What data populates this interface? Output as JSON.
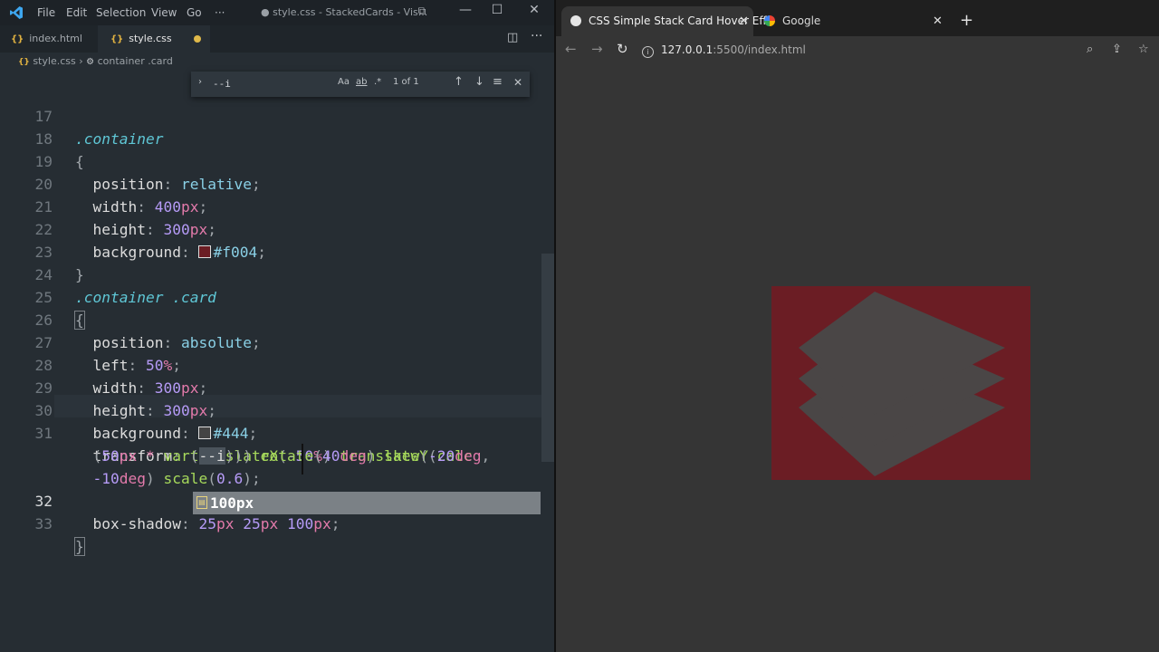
{
  "vscode": {
    "menu": [
      "File",
      "Edit",
      "Selection",
      "View",
      "Go",
      "···"
    ],
    "window_title": "● style.css - StackedCards - Vis...",
    "tabs": [
      {
        "icon": "{}",
        "label": "index.html"
      },
      {
        "icon": "{}",
        "label": "style.css",
        "unsaved": true
      }
    ],
    "breadcrumb": {
      "file": "style.css",
      "separator": "›",
      "symbol": "container .card"
    },
    "find_widget": {
      "value": "--i",
      "match_case": "Aa",
      "whole_word": "ab",
      "regex": ".*",
      "result": "1 of 1"
    },
    "lines": [
      {
        "n": "17",
        "text": ".container"
      },
      {
        "n": "18",
        "text": "{"
      },
      {
        "n": "19",
        "text": "  position: relative;"
      },
      {
        "n": "20",
        "text": "  width: 400px;"
      },
      {
        "n": "21",
        "text": "  height: 300px;"
      },
      {
        "n": "22",
        "text": "  background: ■#f004;"
      },
      {
        "n": "23",
        "text": "}"
      },
      {
        "n": "24",
        "text": ".container .card"
      },
      {
        "n": "25",
        "text": "{"
      },
      {
        "n": "26",
        "text": "  position: absolute;"
      },
      {
        "n": "27",
        "text": "  left: 50%;"
      },
      {
        "n": "28",
        "text": "  width: 300px;"
      },
      {
        "n": "29",
        "text": "  height: 300px;"
      },
      {
        "n": "30",
        "text": "  background: □#444;"
      },
      {
        "n": "31",
        "text": "  transform: translateX(-50%) translateY(calc"
      },
      {
        "n": "",
        "text": "  (50px * var(--i))) rotate(40deg) skew(-20deg,"
      },
      {
        "n": "",
        "text": "  -10deg) scale(0.6);"
      },
      {
        "n": "32",
        "text": "  box-shadow: 25px 25px 100px;"
      },
      {
        "n": "33",
        "text": "}"
      }
    ],
    "suggestion": {
      "icon": "▤",
      "label": "100px"
    },
    "colors": {
      "swatch_1": "#ff000044",
      "swatch_2": "#444444"
    }
  },
  "chrome": {
    "tabs": [
      {
        "title": "CSS Simple Stack Card Hover Effe",
        "active": true
      },
      {
        "title": "Google",
        "active": false
      }
    ],
    "new_tab": "+",
    "url_host": "127.0.0.1",
    "url_path": ":5500/index.html"
  }
}
